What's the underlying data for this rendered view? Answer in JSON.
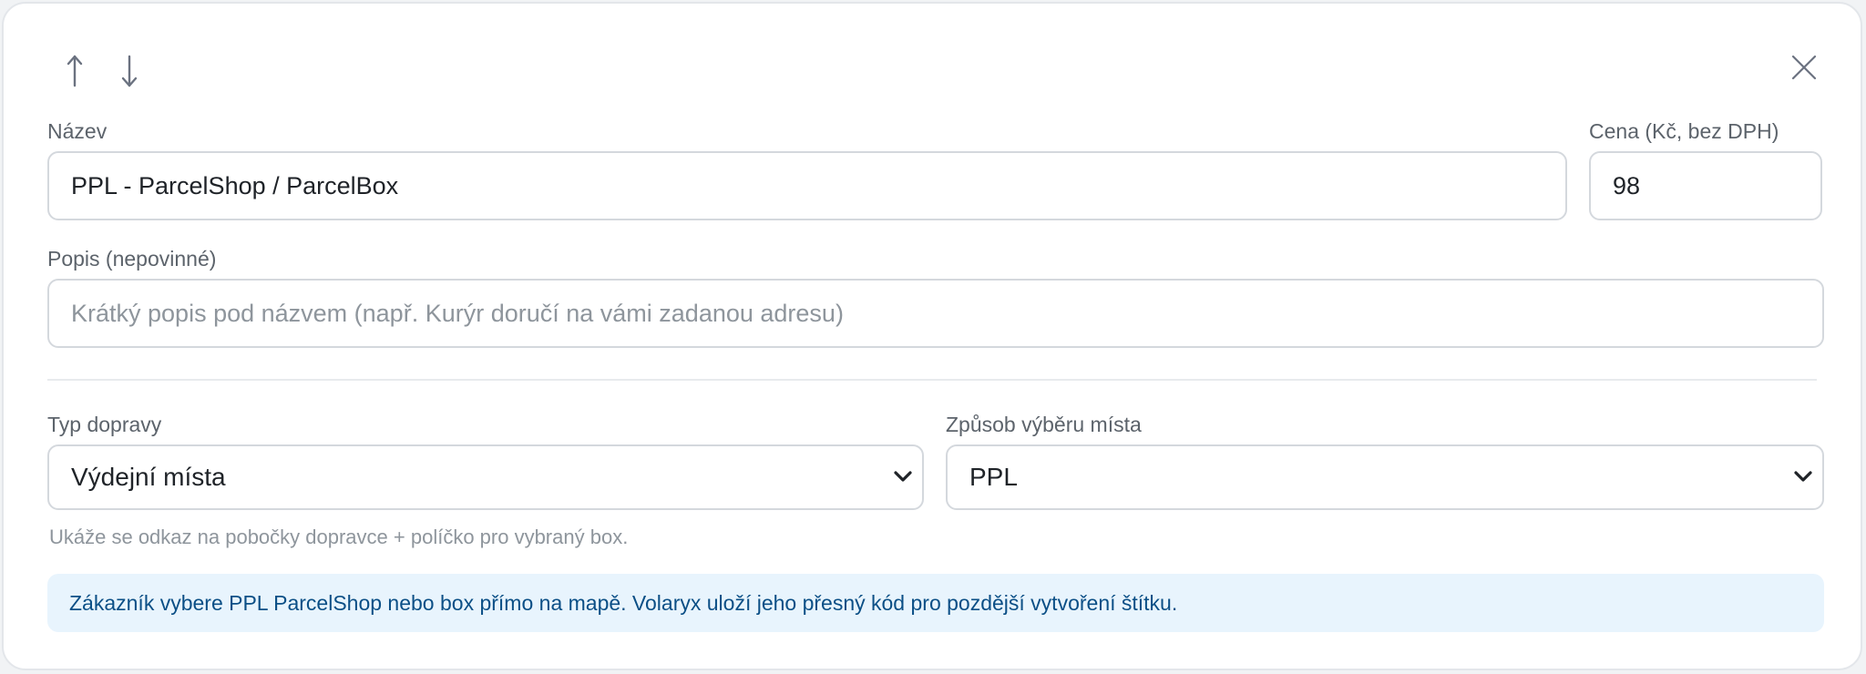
{
  "controls": {
    "move_up_icon": "arrow-up-icon",
    "move_down_icon": "arrow-down-icon",
    "close_icon": "close-icon"
  },
  "name": {
    "label": "Název",
    "value": "PPL - ParcelShop / ParcelBox"
  },
  "price": {
    "label": "Cena (Kč, bez DPH)",
    "value": "98"
  },
  "description": {
    "label": "Popis (nepovinné)",
    "value": "",
    "placeholder": "Krátký popis pod názvem (např. Kurýr doručí na vámi zadanou adresu)"
  },
  "shipping_type": {
    "label": "Typ dopravy",
    "selected": "Výdejní místa"
  },
  "pickup_method": {
    "label": "Způsob výběru místa",
    "selected": "PPL"
  },
  "hint": "Ukáže se odkaz na pobočky dopravce + políčko pro vybraný box.",
  "info": "Zákazník vybere PPL ParcelShop nebo box přímo na mapě. Volaryx uloží jeho přesný kód pro pozdější vytvoření štítku.",
  "colors": {
    "info_background": "#e8f4fd",
    "info_text": "#0b4f86",
    "border": "#d4d8dd"
  }
}
